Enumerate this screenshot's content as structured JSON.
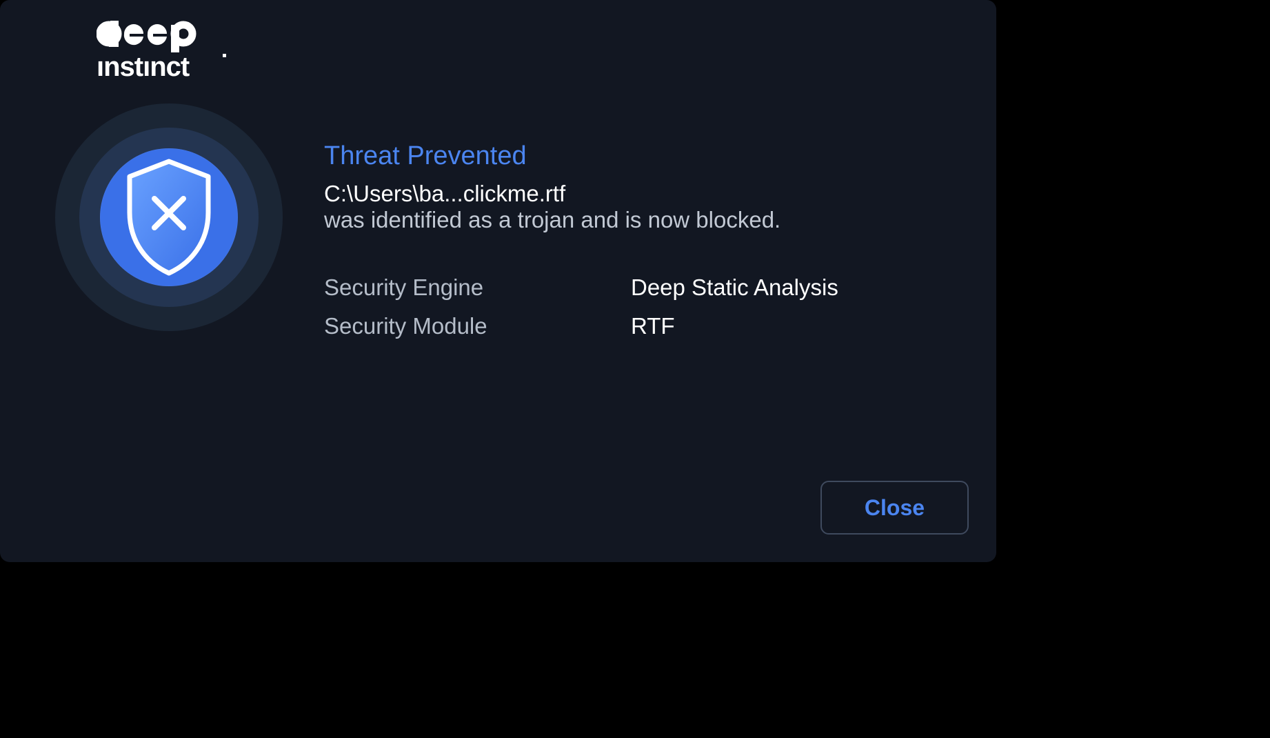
{
  "brand": {
    "name": "deep instinct"
  },
  "alert": {
    "title": "Threat Prevented",
    "file_path": "C:\\Users\\ba...clickme.rtf",
    "description": "was identified as a trojan and is now blocked."
  },
  "details": {
    "engine_label": "Security Engine",
    "engine_value": "Deep Static Analysis",
    "module_label": "Security Module",
    "module_value": "RTF"
  },
  "actions": {
    "close_label": "Close"
  },
  "colors": {
    "accent": "#4b85f0",
    "background": "#121722"
  }
}
